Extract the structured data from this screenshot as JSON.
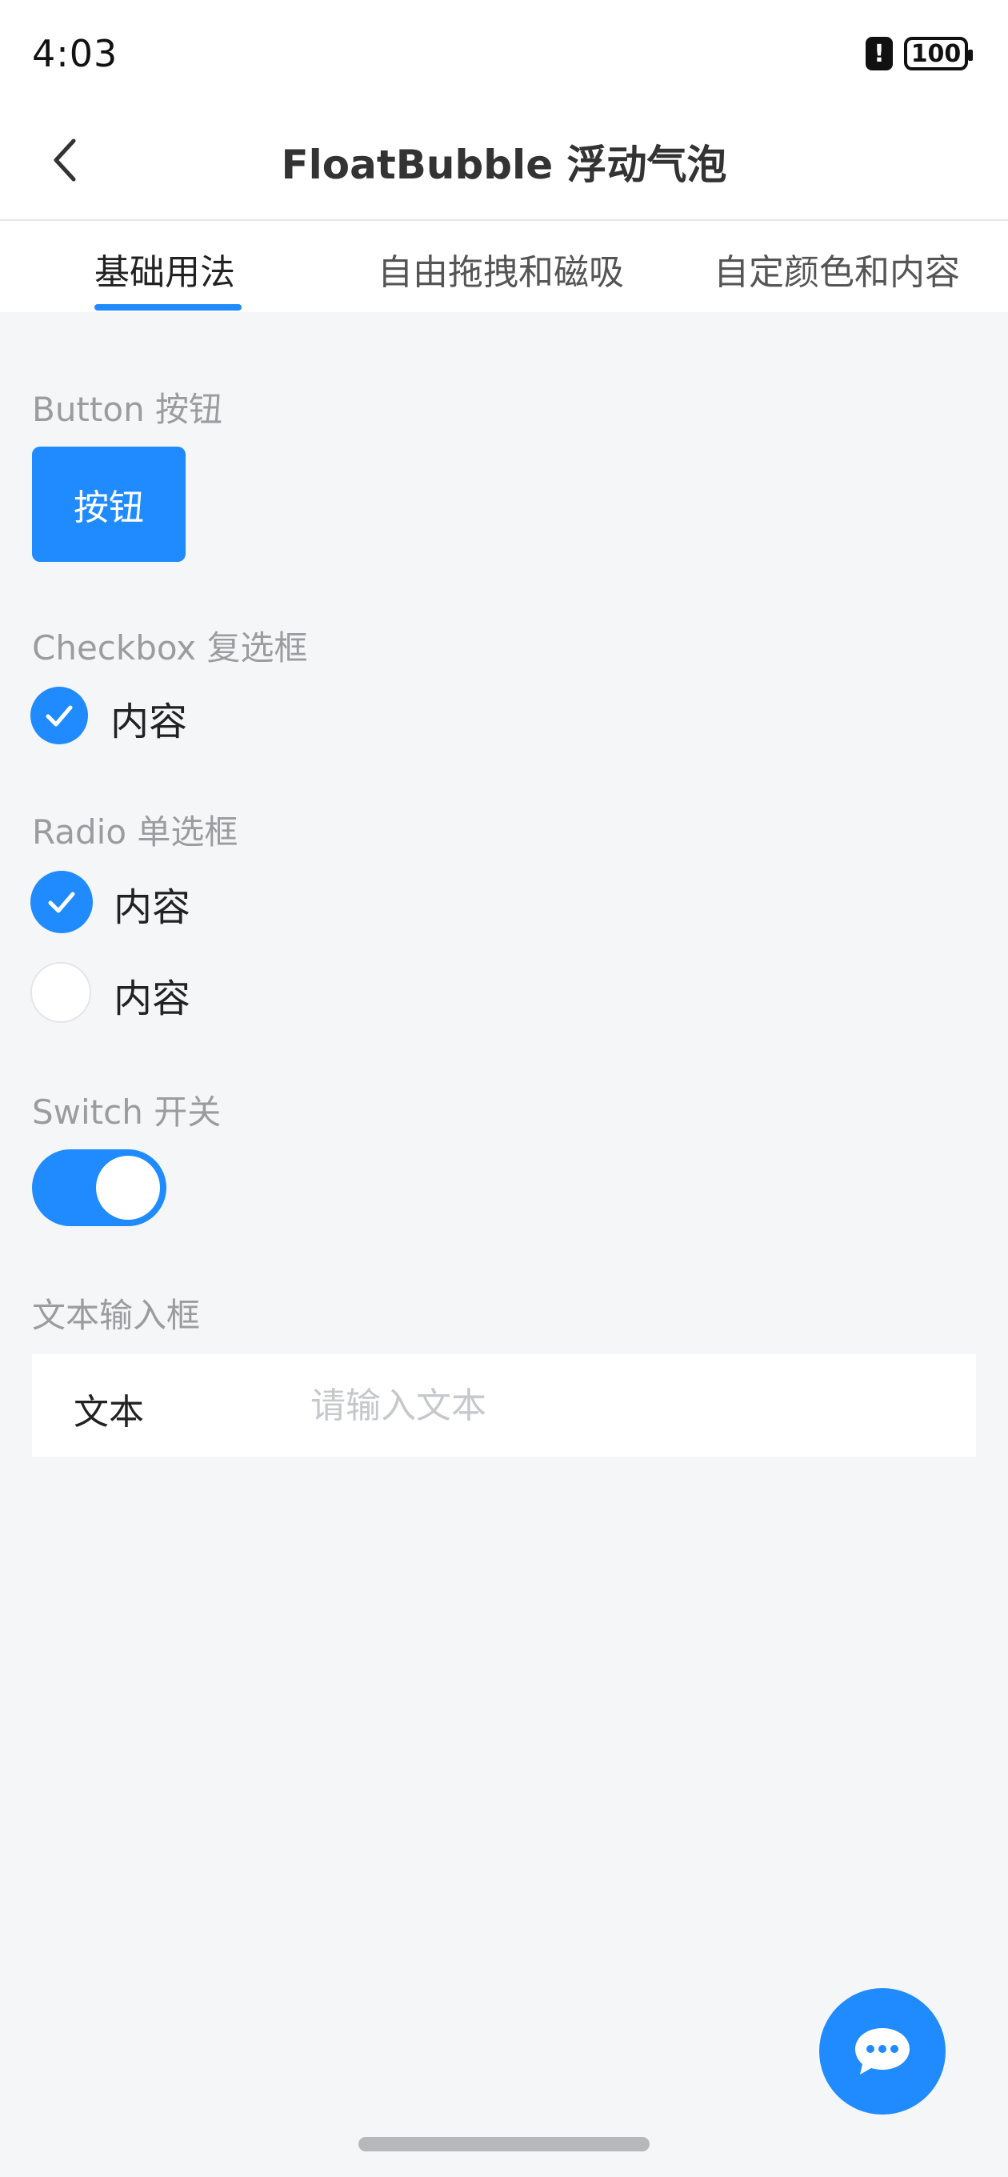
{
  "status_bar": {
    "time": "4:03",
    "alert_glyph": "!",
    "battery": "100"
  },
  "header": {
    "title": "FloatBubble 浮动气泡",
    "back_icon": "chevron-left-icon"
  },
  "tabs": [
    {
      "label": "基础用法",
      "active": true
    },
    {
      "label": "自由拖拽和磁吸",
      "active": false
    },
    {
      "label": "自定颜色和内容",
      "active": false
    }
  ],
  "sections": {
    "button": {
      "title": "Button 按钮",
      "label": "按钮"
    },
    "checkbox": {
      "title": "Checkbox 复选框",
      "label": "内容",
      "checked": true
    },
    "radio": {
      "title": "Radio 单选框",
      "options": [
        {
          "label": "内容",
          "checked": true
        },
        {
          "label": "内容",
          "checked": false
        }
      ]
    },
    "switch": {
      "title": "Switch 开关",
      "on": true
    },
    "text_input": {
      "title": "文本输入框",
      "label": "文本",
      "value": "",
      "placeholder": "请输入文本"
    }
  },
  "float_bubble": {
    "icon": "chat-bubble-icon"
  },
  "colors": {
    "accent": "#1f8bff",
    "background": "#f5f6f8",
    "muted_text": "#9a9ca0"
  }
}
